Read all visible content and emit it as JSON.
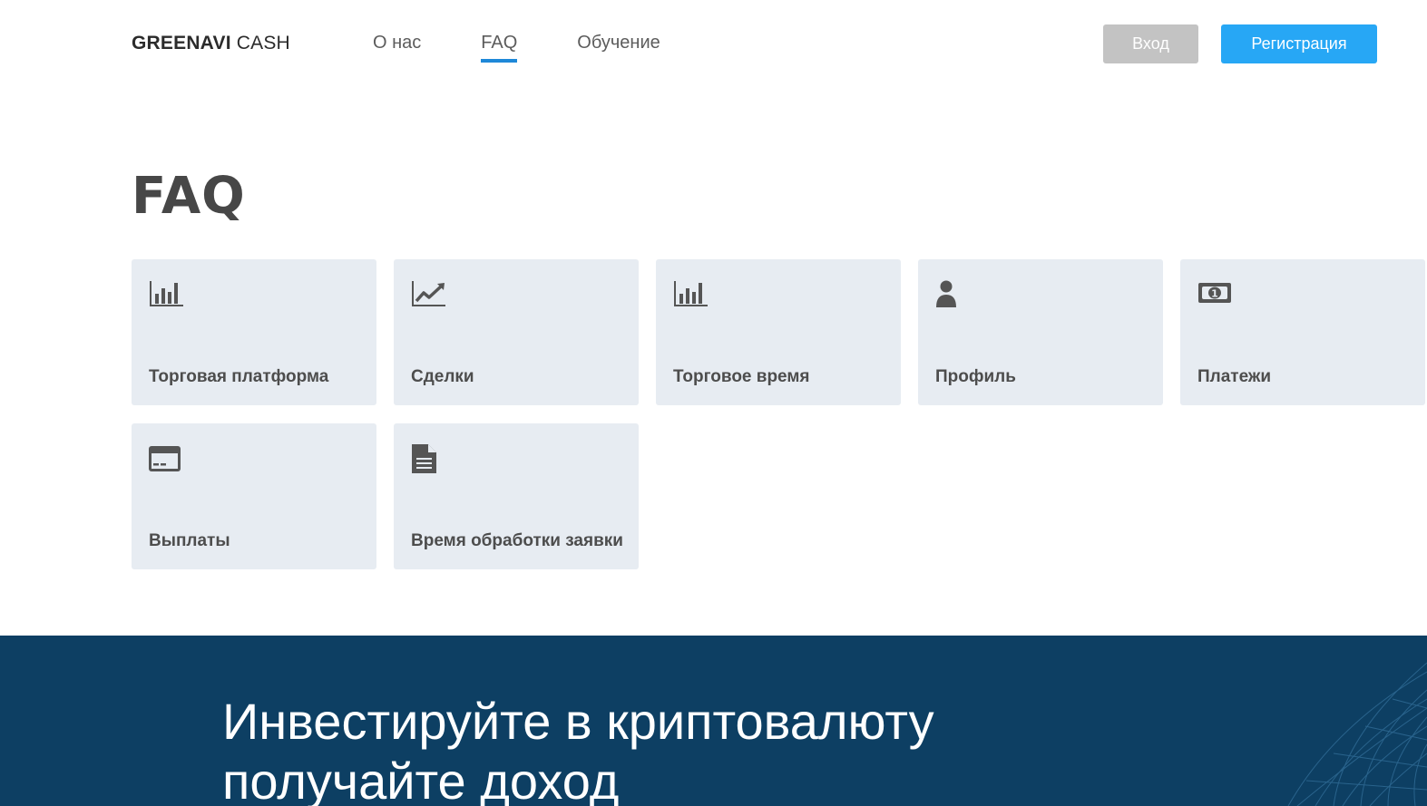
{
  "header": {
    "logo_bold": "GREENAVI",
    "logo_light": "CASH",
    "nav": [
      {
        "label": "О нас",
        "active": false
      },
      {
        "label": "FAQ",
        "active": true
      },
      {
        "label": "Обучение",
        "active": false
      }
    ],
    "login_label": "Вход",
    "register_label": "Регистрация"
  },
  "main": {
    "title": "FAQ",
    "cards": [
      {
        "label": "Торговая платформа",
        "icon": "bar-chart-icon"
      },
      {
        "label": "Сделки",
        "icon": "line-chart-icon"
      },
      {
        "label": "Торговое время",
        "icon": "bar-chart-icon"
      },
      {
        "label": "Профиль",
        "icon": "user-icon"
      },
      {
        "label": "Платежи",
        "icon": "banknote-icon"
      },
      {
        "label": "Выплаты",
        "icon": "credit-card-icon"
      },
      {
        "label": "Время обработки заявки",
        "icon": "document-icon"
      }
    ]
  },
  "banner": {
    "line1": "Инвестируйте в криптовалюту",
    "line2": "получайте доход"
  },
  "colors": {
    "accent": "#27a7f5",
    "nav_underline": "#1e88d8",
    "card_bg": "#e7ecf2",
    "banner_bg": "#0d3f63",
    "login_bg": "#c3c3c3"
  }
}
